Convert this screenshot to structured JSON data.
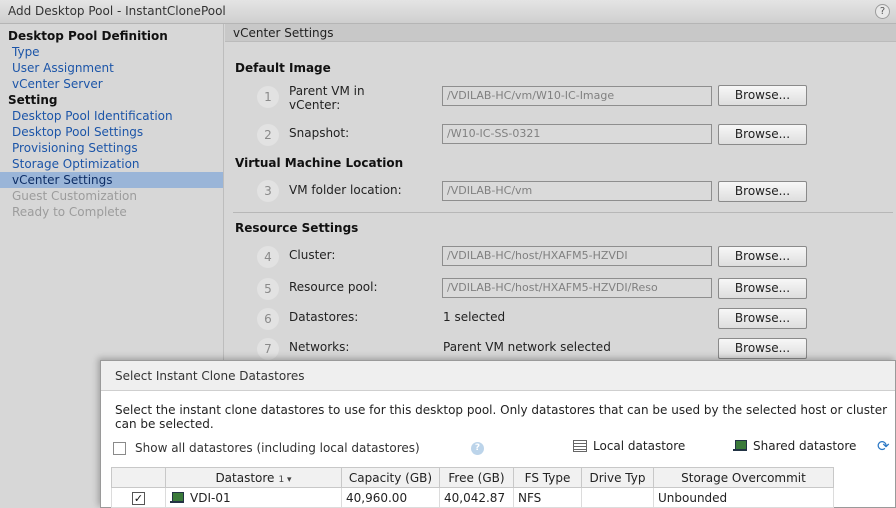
{
  "window": {
    "title": "Add Desktop Pool - InstantClonePool",
    "help": "?"
  },
  "nav": {
    "sections": [
      {
        "header": "Desktop Pool Definition",
        "items": [
          {
            "label": "Type",
            "state": "link"
          },
          {
            "label": "User Assignment",
            "state": "link"
          },
          {
            "label": "vCenter Server",
            "state": "link"
          }
        ]
      },
      {
        "header": "Setting",
        "items": [
          {
            "label": "Desktop Pool Identification",
            "state": "link"
          },
          {
            "label": "Desktop Pool Settings",
            "state": "link"
          },
          {
            "label": "Provisioning Settings",
            "state": "link"
          },
          {
            "label": "Storage Optimization",
            "state": "link"
          },
          {
            "label": "vCenter Settings",
            "state": "selected"
          },
          {
            "label": "Guest Customization",
            "state": "disabled"
          },
          {
            "label": "Ready to Complete",
            "state": "disabled"
          }
        ]
      }
    ]
  },
  "panel": {
    "title": "vCenter Settings",
    "default_image": {
      "title": "Default Image",
      "fields": [
        {
          "step": "1",
          "label": "Parent VM in vCenter:",
          "value": "/VDILAB-HC/vm/W10-IC-Image",
          "button": "Browse..."
        },
        {
          "step": "2",
          "label": "Snapshot:",
          "value": "/W10-IC-SS-0321",
          "button": "Browse..."
        }
      ]
    },
    "vm_location": {
      "title": "Virtual Machine Location",
      "fields": [
        {
          "step": "3",
          "label": "VM folder location:",
          "value": "/VDILAB-HC/vm",
          "button": "Browse..."
        }
      ]
    },
    "resource_settings": {
      "title": "Resource Settings",
      "fields": [
        {
          "step": "4",
          "label": "Cluster:",
          "value": "/VDILAB-HC/host/HXAFM5-HZVDI",
          "button": "Browse..."
        },
        {
          "step": "5",
          "label": "Resource pool:",
          "value": "/VDILAB-HC/host/HXAFM5-HZVDI/Reso",
          "button": "Browse..."
        },
        {
          "step": "6",
          "label": "Datastores:",
          "value": "1 selected",
          "button": "Browse..."
        },
        {
          "step": "7",
          "label": "Networks:",
          "value": "Parent VM network selected",
          "button": "Browse..."
        }
      ]
    }
  },
  "dialog": {
    "title": "Select Instant Clone Datastores",
    "description": "Select the instant clone datastores to use for this desktop pool. Only datastores that can be used by the selected host or cluster can be selected.",
    "show_all_label": "Show all datastores (including local datastores)",
    "show_all_checked": false,
    "help": "?",
    "legend": {
      "local": "Local datastore",
      "shared": "Shared datastore"
    },
    "table": {
      "columns": [
        "",
        "Datastore",
        "Capacity (GB)",
        "Free (GB)",
        "FS Type",
        "Drive Typ",
        "Storage Overcommit"
      ],
      "sort_indicator": "1 ▾",
      "rows": [
        {
          "checked": "✓",
          "name": "VDI-01",
          "capacity": "40,960.00",
          "free": "40,042.87",
          "fs_type": "NFS",
          "drive_type": "",
          "overcommit": "Unbounded"
        }
      ]
    }
  }
}
